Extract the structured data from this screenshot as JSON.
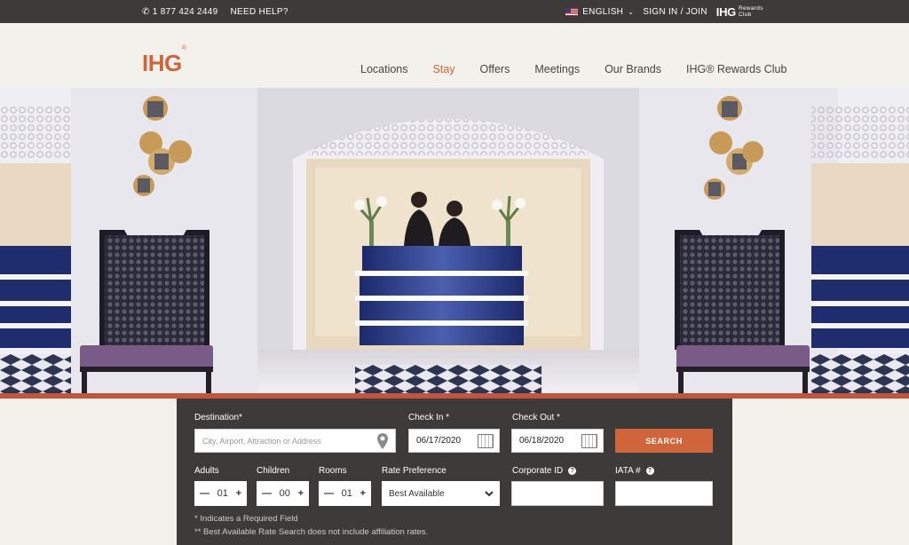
{
  "topbar": {
    "phone": "1 877 424 2449",
    "help": "NEED HELP?",
    "language": "ENGLISH",
    "sign_in": "SIGN IN / JOIN",
    "brand": "IHG",
    "rewards": "Rewards Club"
  },
  "header": {
    "logo": "IHG",
    "nav": [
      {
        "label": "Locations"
      },
      {
        "label": "Stay"
      },
      {
        "label": "Offers"
      },
      {
        "label": "Meetings"
      },
      {
        "label": "Our Brands"
      },
      {
        "label": "IHG® Rewards Club"
      }
    ],
    "active_nav": "Stay"
  },
  "search": {
    "destination_label": "Destination*",
    "destination_placeholder": "City, Airport, Attraction or Address",
    "checkin_label": "Check In *",
    "checkin_value": "06/17/2020",
    "checkout_label": "Check Out *",
    "checkout_value": "06/18/2020",
    "search_button": "SEARCH",
    "adults_label": "Adults",
    "adults_value": "01",
    "children_label": "Children",
    "children_value": "00",
    "rooms_label": "Rooms",
    "rooms_value": "01",
    "rate_label": "Rate Preference",
    "rate_value": "Best Available",
    "corporate_label": "Corporate ID",
    "iata_label": "IATA #",
    "note_required": "* Indicates a Required Field",
    "note_rate": "** Best Available Rate Search does not include affiliation rates."
  },
  "colors": {
    "accent": "#d0643b",
    "dark": "#3d3b39",
    "hero_stripe": "#c4553a"
  }
}
